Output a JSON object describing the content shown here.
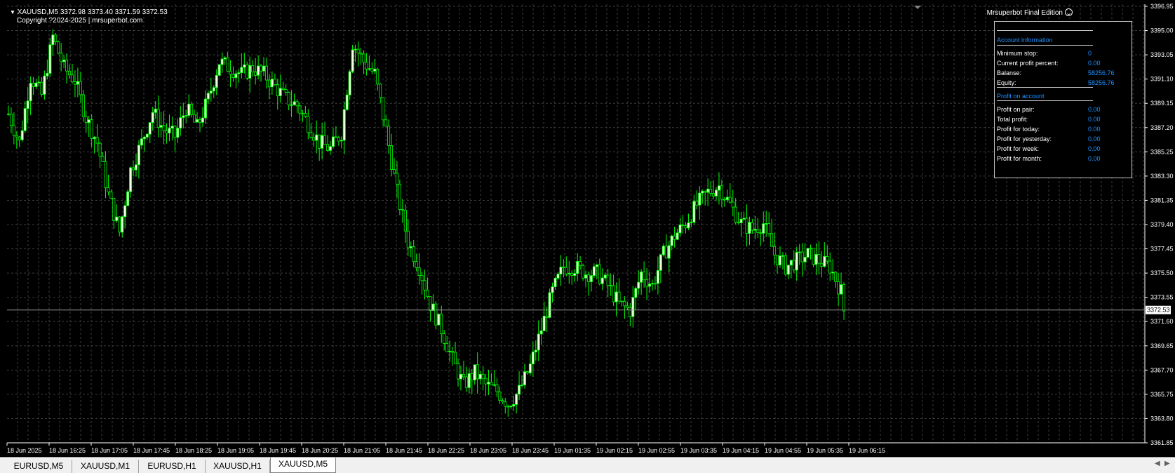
{
  "header": {
    "symbol_line": "XAUUSD,M5  3372.98 3373.40 3371.59 3372.53",
    "copyright": "Copyright ?2024-2025 | mrsuperbot.com",
    "ea_name": "Mrsuperbot Final Edition"
  },
  "panel": {
    "account_header": "Account information",
    "account_rows": [
      {
        "label": "Minimum stop:",
        "value": "0"
      },
      {
        "label": "Current profit percent:",
        "value": "0.00"
      },
      {
        "label": "Balanse:",
        "value": "58256.76"
      },
      {
        "label": "Equity:",
        "value": "58256.76"
      }
    ],
    "profit_header": "Profit on account",
    "profit_rows": [
      {
        "label": "Profit on pair:",
        "value": "0.00"
      },
      {
        "label": "Total profit:",
        "value": "0.00"
      },
      {
        "label": "Profit for today:",
        "value": "0.00"
      },
      {
        "label": "Profit for yesterday:",
        "value": "0.00"
      },
      {
        "label": "Profit for week:",
        "value": "0.00"
      },
      {
        "label": "Profit for month:",
        "value": "0.00"
      }
    ]
  },
  "tabs": [
    {
      "label": "EURUSD,M5",
      "active": false
    },
    {
      "label": "XAUUSD,M1",
      "active": false
    },
    {
      "label": "EURUSD,H1",
      "active": false
    },
    {
      "label": "XAUUSD,H1",
      "active": false
    },
    {
      "label": "XAUUSD,M5",
      "active": true
    }
  ],
  "colors": {
    "background": "#000000",
    "grid": "#3c3c3c",
    "candle": "#00ff00",
    "bull_body": "#f0ffe0",
    "bear_body": "#000000",
    "axis_text": "#ffffff",
    "panel_accent": "#1e90ff"
  },
  "chart_data": {
    "type": "candlestick",
    "symbol": "XAUUSD",
    "timeframe": "M5",
    "current_price": "3372.53",
    "ylim": [
      3361.85,
      3396.95
    ],
    "y_ticks": [
      "3396.95",
      "3395.00",
      "3393.05",
      "3391.10",
      "3389.15",
      "3387.20",
      "3385.25",
      "3383.30",
      "3381.35",
      "3379.40",
      "3377.45",
      "3375.50",
      "3373.55",
      "3371.60",
      "3369.65",
      "3367.70",
      "3365.75",
      "3363.80",
      "3361.85"
    ],
    "x_ticks": [
      "18 Jun 2025",
      "18 Jun 16:25",
      "18 Jun 17:05",
      "18 Jun 17:45",
      "18 Jun 18:25",
      "18 Jun 19:05",
      "18 Jun 19:45",
      "18 Jun 20:25",
      "18 Jun 21:05",
      "18 Jun 21:45",
      "18 Jun 22:25",
      "18 Jun 23:05",
      "18 Jun 23:45",
      "19 Jun 01:35",
      "19 Jun 02:15",
      "19 Jun 02:55",
      "19 Jun 03:35",
      "19 Jun 04:15",
      "19 Jun 04:55",
      "19 Jun 05:35",
      "19 Jun 06:15"
    ],
    "path_points": [
      [
        0,
        3388.3
      ],
      [
        4,
        3386.0
      ],
      [
        8,
        3391.3
      ],
      [
        12,
        3389.8
      ],
      [
        16,
        3394.5
      ],
      [
        20,
        3392.0
      ],
      [
        24,
        3391.0
      ],
      [
        28,
        3388.0
      ],
      [
        32,
        3386.0
      ],
      [
        36,
        3381.8
      ],
      [
        40,
        3378.8
      ],
      [
        44,
        3383.8
      ],
      [
        48,
        3386.0
      ],
      [
        52,
        3388.5
      ],
      [
        56,
        3387.0
      ],
      [
        60,
        3386.5
      ],
      [
        64,
        3388.8
      ],
      [
        68,
        3387.2
      ],
      [
        72,
        3389.5
      ],
      [
        76,
        3392.5
      ],
      [
        80,
        3392.0
      ],
      [
        84,
        3391.5
      ],
      [
        88,
        3392.0
      ],
      [
        92,
        3391.5
      ],
      [
        96,
        3390.5
      ],
      [
        100,
        3389.5
      ],
      [
        104,
        3389.0
      ],
      [
        108,
        3387.5
      ],
      [
        112,
        3386.0
      ],
      [
        116,
        3385.5
      ],
      [
        120,
        3386.8
      ],
      [
        124,
        3394.0
      ],
      [
        128,
        3392.5
      ],
      [
        132,
        3391.5
      ],
      [
        136,
        3387.0
      ],
      [
        140,
        3382.0
      ],
      [
        144,
        3378.0
      ],
      [
        148,
        3376.0
      ],
      [
        152,
        3373.0
      ],
      [
        156,
        3371.0
      ],
      [
        160,
        3368.5
      ],
      [
        164,
        3366.5
      ],
      [
        168,
        3367.5
      ],
      [
        172,
        3366.5
      ],
      [
        176,
        3366.0
      ],
      [
        180,
        3365.0
      ],
      [
        184,
        3366.0
      ],
      [
        188,
        3368.0
      ],
      [
        192,
        3371.0
      ],
      [
        196,
        3374.0
      ],
      [
        200,
        3376.0
      ],
      [
        204,
        3376.0
      ],
      [
        208,
        3375.5
      ],
      [
        212,
        3375.5
      ],
      [
        216,
        3374.5
      ],
      [
        220,
        3373.0
      ],
      [
        224,
        3372.5
      ],
      [
        228,
        3375.5
      ],
      [
        232,
        3374.5
      ],
      [
        236,
        3377.0
      ],
      [
        240,
        3378.5
      ],
      [
        244,
        3379.5
      ],
      [
        248,
        3381.0
      ],
      [
        252,
        3382.0
      ],
      [
        256,
        3382.5
      ],
      [
        260,
        3381.0
      ],
      [
        264,
        3379.5
      ],
      [
        268,
        3379.0
      ],
      [
        272,
        3379.5
      ],
      [
        276,
        3377.0
      ],
      [
        280,
        3376.0
      ],
      [
        284,
        3376.5
      ],
      [
        288,
        3377.0
      ],
      [
        292,
        3376.5
      ],
      [
        296,
        3376.0
      ],
      [
        300,
        3374.0
      ],
      [
        301,
        3372.5
      ]
    ]
  }
}
